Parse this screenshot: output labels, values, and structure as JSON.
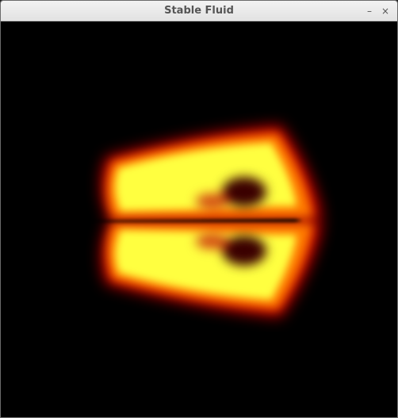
{
  "window": {
    "title": "Stable Fluid",
    "minimize_glyph": "–",
    "close_glyph": "×"
  },
  "colors": {
    "titlebar": "#e8e8e8",
    "background": "#000000",
    "fluid_core": "#ffff33",
    "fluid_mid": "#ff8c00",
    "fluid_edge": "#cc0000"
  },
  "icons": {
    "minimize": "minimize-icon",
    "close": "close-icon"
  }
}
